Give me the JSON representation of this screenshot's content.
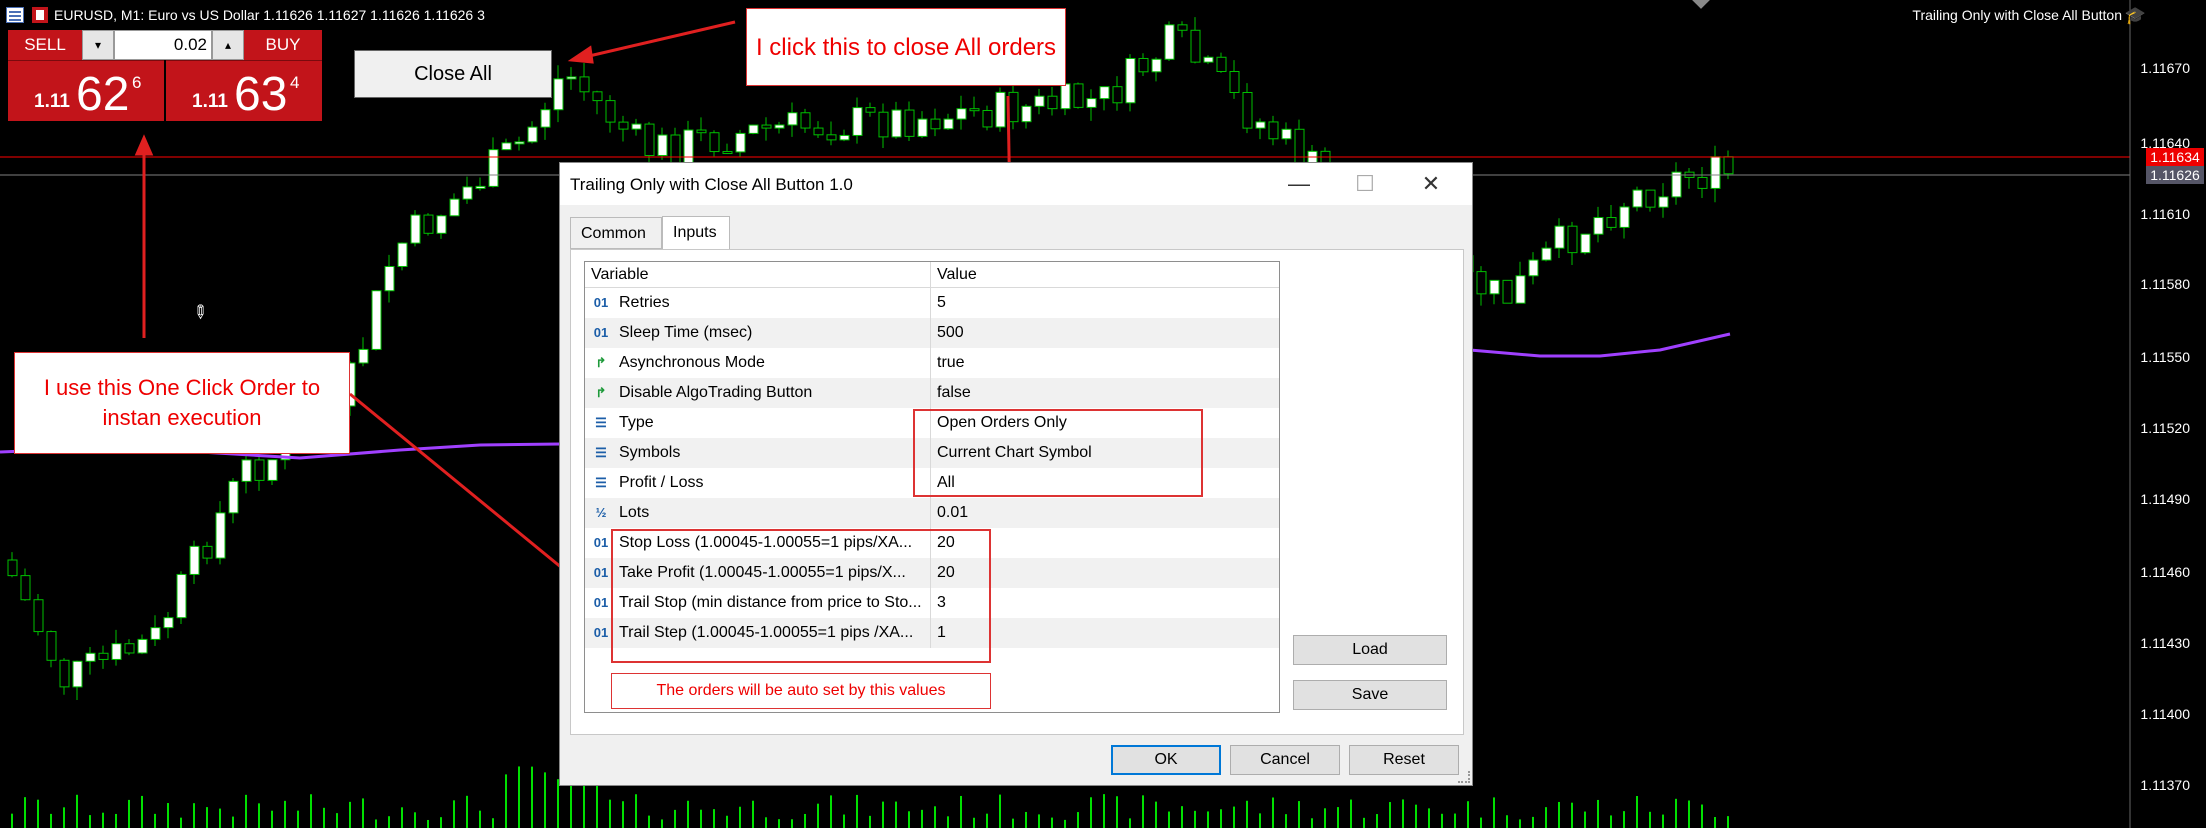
{
  "chart": {
    "title": "EURUSD, M1:  Euro vs US Dollar  1.11626 1.11627 1.11626 1.11626  3",
    "ea_name": "Trailing Only with Close All Button",
    "price_labels": [
      "1.11670",
      "1.11640",
      "1.11610",
      "1.11580",
      "1.11550",
      "1.11520",
      "1.11490",
      "1.11460",
      "1.11430",
      "1.11400",
      "1.11370"
    ],
    "ask_tag": "1.11634",
    "bid_tag": "1.11626",
    "colors": {
      "bull": "#ffffff",
      "bear": "#00c000",
      "ma": "#a040ff",
      "ask_line": "#ff0000",
      "bid_line": "#808080",
      "volume": "#00e000",
      "one_click": "#c2141a",
      "callout_text": "#e00000"
    }
  },
  "one_click": {
    "sell_label": "SELL",
    "buy_label": "BUY",
    "lot": "0.02",
    "sell_price": {
      "small": "1.11",
      "big": "62",
      "sup": "6"
    },
    "buy_price": {
      "small": "1.11",
      "big": "63",
      "sup": "4"
    }
  },
  "close_all_label": "Close All",
  "callouts": {
    "close_all": "I click this to close All orders",
    "one_click": "I use this One Click Order to instan execution",
    "values": "The orders will be auto set by this values"
  },
  "dialog": {
    "title": "Trailing Only with Close All Button 1.0",
    "tabs": [
      {
        "label": "Common"
      },
      {
        "label": "Inputs"
      }
    ],
    "columns": {
      "variable": "Variable",
      "value": "Value"
    },
    "rows": [
      {
        "icon": "01",
        "variable": "Retries",
        "value": "5"
      },
      {
        "icon": "01",
        "variable": "Sleep Time (msec)",
        "value": "500"
      },
      {
        "icon": "arrow",
        "variable": "Asynchronous Mode",
        "value": "true"
      },
      {
        "icon": "arrow",
        "variable": "Disable AlgoTrading Button",
        "value": "false"
      },
      {
        "icon": "list",
        "variable": "Type",
        "value": "Open Orders Only"
      },
      {
        "icon": "list",
        "variable": "Symbols",
        "value": "Current Chart Symbol"
      },
      {
        "icon": "list",
        "variable": "Profit / Loss",
        "value": "All"
      },
      {
        "icon": "½",
        "variable": "Lots",
        "value": "0.01"
      },
      {
        "icon": "01",
        "variable": "Stop Loss (1.00045-1.00055=1 pips/XA...",
        "value": "20"
      },
      {
        "icon": "01",
        "variable": "Take Profit (1.00045-1.00055=1 pips/X...",
        "value": "20"
      },
      {
        "icon": "01",
        "variable": "Trail Stop (min distance from price to Sto...",
        "value": "3"
      },
      {
        "icon": "01",
        "variable": "Trail Step (1.00045-1.00055=1 pips /XA...",
        "value": "1"
      }
    ],
    "load_label": "Load",
    "save_label": "Save",
    "ok_label": "OK",
    "cancel_label": "Cancel",
    "reset_label": "Reset"
  }
}
